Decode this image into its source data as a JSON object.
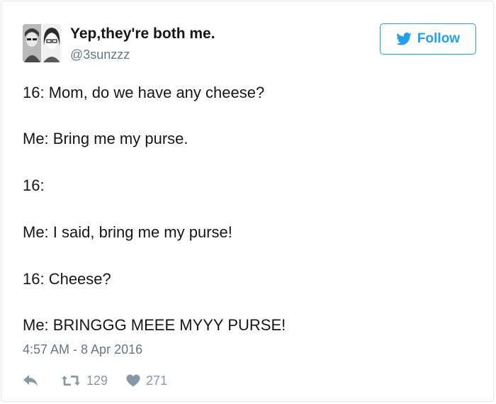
{
  "author": {
    "display_name": "Yep,they're both me.",
    "handle": "@3sunzzz",
    "avatar_icon": "avatar-collage"
  },
  "follow_button": {
    "label": "Follow",
    "icon": "twitter-bird-icon",
    "color": "#1da1f2"
  },
  "tweet": {
    "lines": [
      "16: Mom, do we have any cheese?",
      "Me: Bring me my purse.",
      "16:",
      "Me: I said, bring me my purse!",
      "16: Cheese?",
      "Me: BRINGGG MEEE MYYY PURSE!"
    ],
    "timestamp": "4:57 AM - 8 Apr 2016"
  },
  "actions": {
    "reply_icon": "reply-icon",
    "retweet_icon": "retweet-icon",
    "retweet_count": "129",
    "like_icon": "heart-icon",
    "like_count": "271"
  },
  "colors": {
    "text": "#14171a",
    "muted": "#657786",
    "action_gray": "#8899a6",
    "accent": "#1da1f2",
    "border": "#e1e8ed"
  }
}
